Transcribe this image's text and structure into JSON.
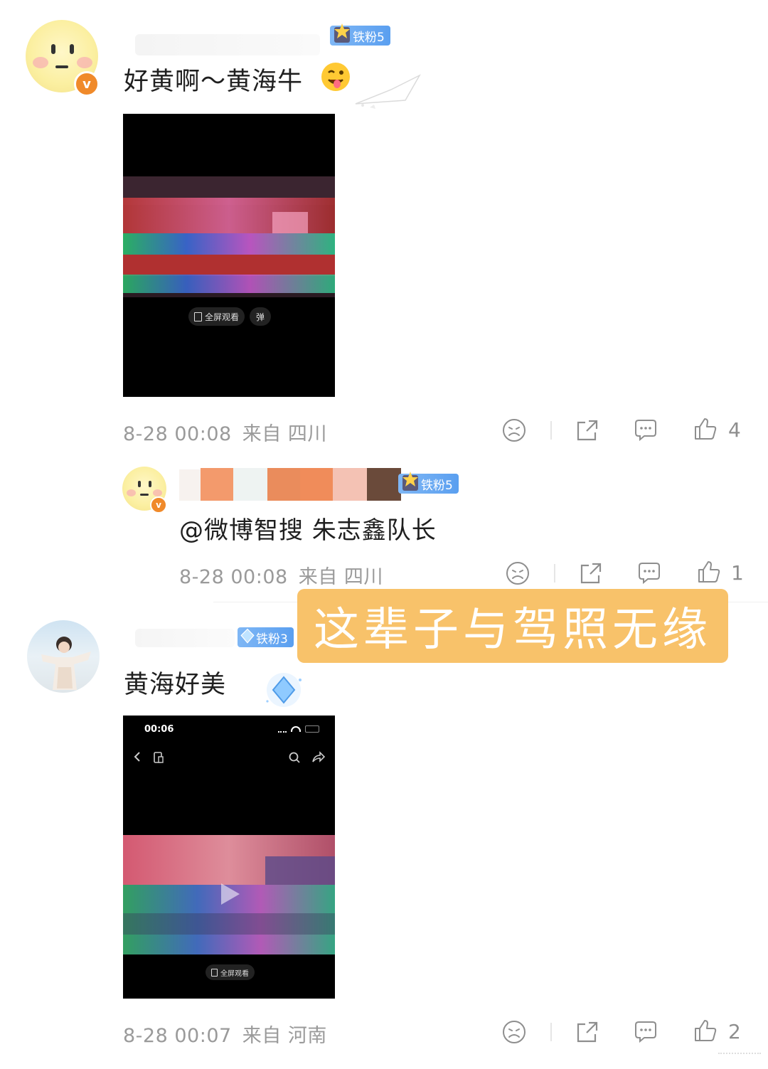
{
  "comments": [
    {
      "text": "好黄啊～黄海牛",
      "fan_badge": "铁粉5",
      "verified": "v",
      "video_overlay": {
        "fullscreen": "全屏观看",
        "danmaku": "弹"
      },
      "time": "8-28 00:08",
      "location": "来自 四川",
      "likes": "4"
    },
    {
      "text": "@微博智搜 朱志鑫队长",
      "fan_badge": "铁粉5",
      "verified": "v",
      "time": "8-28 00:08",
      "location": "来自 四川",
      "likes": "1"
    },
    {
      "text": "黄海好美",
      "fan_badge": "铁粉3",
      "video_status": {
        "time": "00:06"
      },
      "video_overlay": {
        "fullscreen": "全屏观看"
      },
      "time": "8-28 00:07",
      "location": "来自 河南",
      "likes": "2"
    }
  ],
  "caption_overlay": "这辈子与驾照无缘",
  "icons": [
    "sad-face-icon",
    "share-icon",
    "comment-icon",
    "thumbs-up-icon",
    "play-icon",
    "back-icon",
    "search-icon",
    "forward-icon"
  ],
  "colors": {
    "accent_badge": "#5a9ff0",
    "verified": "#f08a2a",
    "overlay": "#f8c26a",
    "meta": "#9a9a9a"
  }
}
